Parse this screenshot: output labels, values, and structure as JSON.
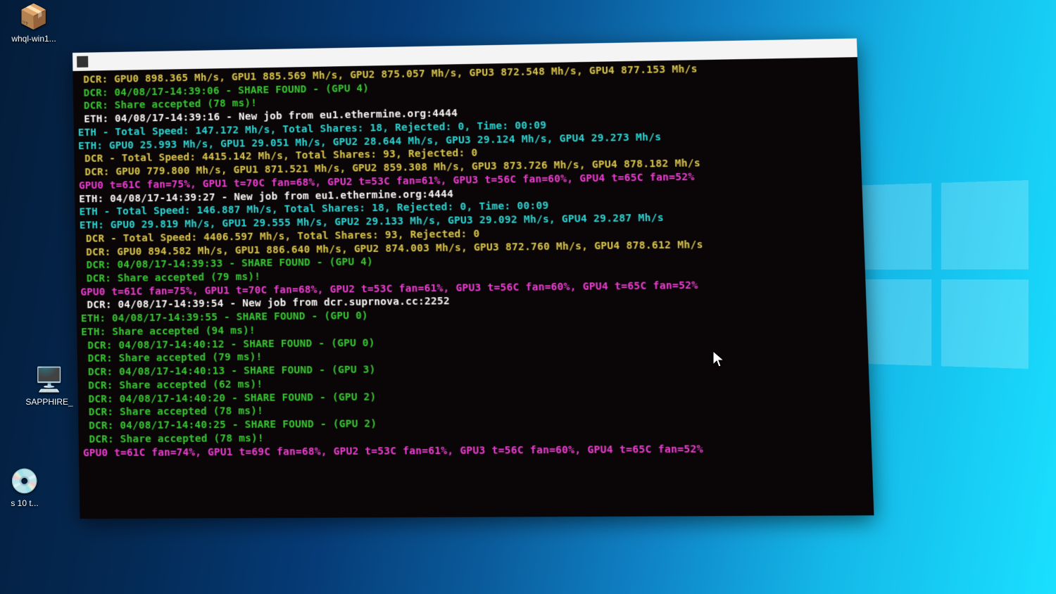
{
  "desktop_icons": {
    "whql": "whql-win1...",
    "sapphire": "SAPPHIRE_",
    "win10": "s 10\nt..."
  },
  "window": {
    "title": " "
  },
  "colors": {
    "yellow": "#d6c24a",
    "green": "#35c432",
    "white": "#f4f4f4",
    "cyan": "#2ad2d2",
    "magenta": "#ea3bd1"
  },
  "log": [
    {
      "color": "yellow",
      "text": " DCR: GPU0 898.365 Mh/s, GPU1 885.569 Mh/s, GPU2 875.057 Mh/s, GPU3 872.548 Mh/s, GPU4 877.153 Mh/s"
    },
    {
      "color": "green",
      "text": " DCR: 04/08/17-14:39:06 - SHARE FOUND - (GPU 4)"
    },
    {
      "color": "green",
      "text": " DCR: Share accepted (78 ms)!"
    },
    {
      "color": "white",
      "text": " ETH: 04/08/17-14:39:16 - New job from eu1.ethermine.org:4444"
    },
    {
      "color": "cyan",
      "text": "ETH - Total Speed: 147.172 Mh/s, Total Shares: 18, Rejected: 0, Time: 00:09"
    },
    {
      "color": "cyan",
      "text": "ETH: GPU0 25.993 Mh/s, GPU1 29.051 Mh/s, GPU2 28.644 Mh/s, GPU3 29.124 Mh/s, GPU4 29.273 Mh/s"
    },
    {
      "color": "yellow",
      "text": " DCR - Total Speed: 4415.142 Mh/s, Total Shares: 93, Rejected: 0"
    },
    {
      "color": "yellow",
      "text": " DCR: GPU0 779.800 Mh/s, GPU1 871.521 Mh/s, GPU2 859.308 Mh/s, GPU3 873.726 Mh/s, GPU4 878.182 Mh/s"
    },
    {
      "color": "magenta",
      "text": "GPU0 t=61C fan=75%, GPU1 t=70C fan=68%, GPU2 t=53C fan=61%, GPU3 t=56C fan=60%, GPU4 t=65C fan=52%"
    },
    {
      "color": "white",
      "text": "ETH: 04/08/17-14:39:27 - New job from eu1.ethermine.org:4444"
    },
    {
      "color": "cyan",
      "text": "ETH - Total Speed: 146.887 Mh/s, Total Shares: 18, Rejected: 0, Time: 00:09"
    },
    {
      "color": "cyan",
      "text": "ETH: GPU0 29.819 Mh/s, GPU1 29.555 Mh/s, GPU2 29.133 Mh/s, GPU3 29.092 Mh/s, GPU4 29.287 Mh/s"
    },
    {
      "color": "yellow",
      "text": " DCR - Total Speed: 4406.597 Mh/s, Total Shares: 93, Rejected: 0"
    },
    {
      "color": "yellow",
      "text": " DCR: GPU0 894.582 Mh/s, GPU1 886.640 Mh/s, GPU2 874.003 Mh/s, GPU3 872.760 Mh/s, GPU4 878.612 Mh/s"
    },
    {
      "color": "green",
      "text": " DCR: 04/08/17-14:39:33 - SHARE FOUND - (GPU 4)"
    },
    {
      "color": "green",
      "text": " DCR: Share accepted (79 ms)!"
    },
    {
      "color": "magenta",
      "text": "GPU0 t=61C fan=75%, GPU1 t=70C fan=68%, GPU2 t=53C fan=61%, GPU3 t=56C fan=60%, GPU4 t=65C fan=52%"
    },
    {
      "color": "white",
      "text": " DCR: 04/08/17-14:39:54 - New job from dcr.suprnova.cc:2252"
    },
    {
      "color": "green",
      "text": "ETH: 04/08/17-14:39:55 - SHARE FOUND - (GPU 0)"
    },
    {
      "color": "green",
      "text": "ETH: Share accepted (94 ms)!"
    },
    {
      "color": "green",
      "text": " DCR: 04/08/17-14:40:12 - SHARE FOUND - (GPU 0)"
    },
    {
      "color": "green",
      "text": " DCR: Share accepted (79 ms)!"
    },
    {
      "color": "green",
      "text": " DCR: 04/08/17-14:40:13 - SHARE FOUND - (GPU 3)"
    },
    {
      "color": "green",
      "text": " DCR: Share accepted (62 ms)!"
    },
    {
      "color": "green",
      "text": " DCR: 04/08/17-14:40:20 - SHARE FOUND - (GPU 2)"
    },
    {
      "color": "green",
      "text": " DCR: Share accepted (78 ms)!"
    },
    {
      "color": "green",
      "text": " DCR: 04/08/17-14:40:25 - SHARE FOUND - (GPU 2)"
    },
    {
      "color": "green",
      "text": " DCR: Share accepted (78 ms)!"
    },
    {
      "color": "magenta",
      "text": "GPU0 t=61C fan=74%, GPU1 t=69C fan=68%, GPU2 t=53C fan=61%, GPU3 t=56C fan=60%, GPU4 t=65C fan=52%"
    }
  ]
}
